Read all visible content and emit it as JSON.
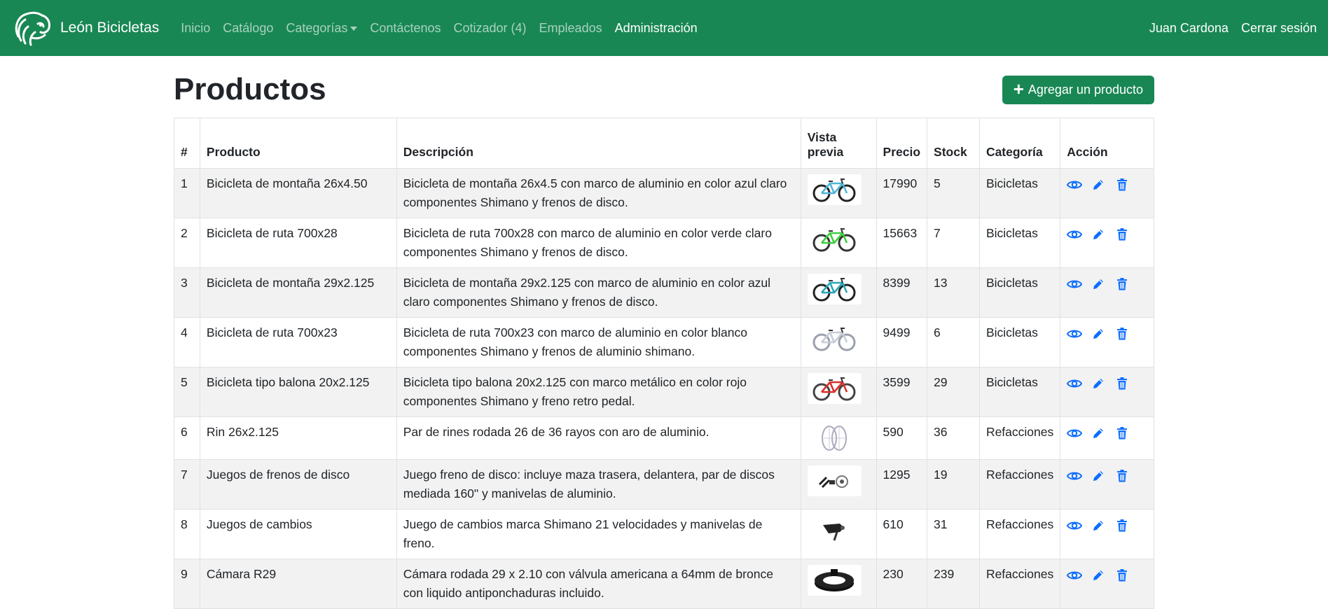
{
  "brand": {
    "name": "León Bicicletas",
    "logo_icon": "lion-head-icon"
  },
  "nav": {
    "links": [
      "Inicio",
      "Catálogo",
      "Categorías",
      "Contáctenos",
      "Cotizador (4)",
      "Empleados",
      "Administración"
    ],
    "user": "Juan Cardona",
    "logout": "Cerrar sesión"
  },
  "page": {
    "title": "Productos",
    "add_button": "Agregar un producto"
  },
  "table": {
    "headers": [
      "#",
      "Producto",
      "Descripción",
      "Vista previa",
      "Precio",
      "Stock",
      "Categoría",
      "Acción"
    ],
    "rows": [
      {
        "id": "1",
        "product": "Bicicleta de montaña 26x4.50",
        "description": "Bicicleta de montaña 26x4.5 con marco de aluminio en color azul claro componentes Shimano y frenos de disco.",
        "preview_icon": "bike-blue-icon",
        "price": "17990",
        "stock": "5",
        "category": "Bicicletas"
      },
      {
        "id": "2",
        "product": "Bicicleta de ruta 700x28",
        "description": "Bicicleta de ruta 700x28 con marco de aluminio en color verde claro componentes Shimano y frenos de disco.",
        "preview_icon": "bike-green-icon",
        "price": "15663",
        "stock": "7",
        "category": "Bicicletas"
      },
      {
        "id": "3",
        "product": "Bicicleta de montaña 29x2.125",
        "description": "Bicicleta de montaña 29x2.125 con marco de aluminio en color azul claro componentes Shimano y frenos de disco.",
        "preview_icon": "bike-teal-icon",
        "price": "8399",
        "stock": "13",
        "category": "Bicicletas"
      },
      {
        "id": "4",
        "product": "Bicicleta de ruta 700x23",
        "description": "Bicicleta de ruta 700x23 con marco de aluminio en color blanco componentes Shimano y frenos de aluminio shimano.",
        "preview_icon": "bike-white-icon",
        "price": "9499",
        "stock": "6",
        "category": "Bicicletas"
      },
      {
        "id": "5",
        "product": "Bicicleta tipo balona 20x2.125",
        "description": "Bicicleta tipo balona 20x2.125 con marco metálico en color rojo componentes Shimano y freno retro pedal.",
        "preview_icon": "bike-red-icon",
        "price": "3599",
        "stock": "29",
        "category": "Bicicletas"
      },
      {
        "id": "6",
        "product": "Rin 26x2.125",
        "description": "Par de rines rodada 26 de 36 rayos con aro de aluminio.",
        "preview_icon": "rims-icon",
        "price": "590",
        "stock": "36",
        "category": "Refacciones"
      },
      {
        "id": "7",
        "product": "Juegos de frenos de disco",
        "description": "Juego freno de disco: incluye maza trasera, delantera, par de discos mediada 160\" y manivelas de aluminio.",
        "preview_icon": "disc-brakes-icon",
        "price": "1295",
        "stock": "19",
        "category": "Refacciones"
      },
      {
        "id": "8",
        "product": "Juegos de cambios",
        "description": "Juego de cambios marca Shimano 21 velocidades y manivelas de freno.",
        "preview_icon": "shifter-icon",
        "price": "610",
        "stock": "31",
        "category": "Refacciones"
      },
      {
        "id": "9",
        "product": "Cámara R29",
        "description": "Cámara rodada 29 x 2.10 con válvula americana a 64mm de bronce con liquido antiponchaduras incluido.",
        "preview_icon": "inner-tube-icon",
        "price": "230",
        "stock": "239",
        "category": "Refacciones"
      }
    ]
  },
  "colors": {
    "navbar": "#198754",
    "action_icon": "#0d6efd",
    "stripe": "#f2f2f2"
  }
}
